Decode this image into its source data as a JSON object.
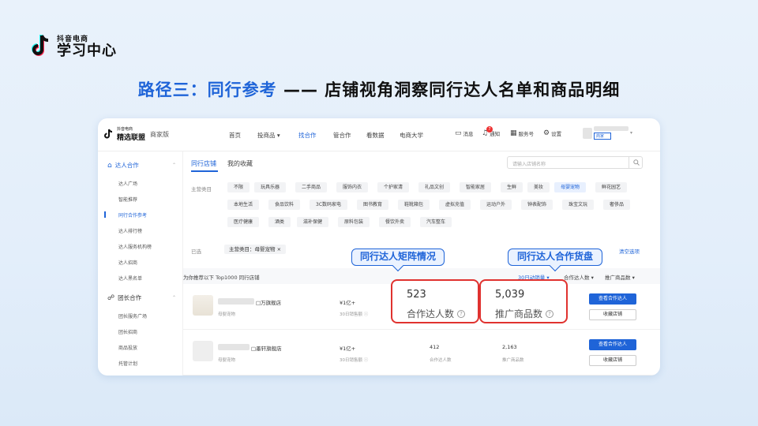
{
  "logo": {
    "top": "抖音电商",
    "main": "学习中心"
  },
  "headline": {
    "part1": "路径三：同行参考",
    "part2": " —— 店铺视角洞察同行达人名单和商品明细"
  },
  "platform": {
    "logo_small": "抖音电商",
    "logo_main": "精选联盟",
    "logo_edition": "商家版",
    "nav": [
      "首页",
      "投商品 ▾",
      "找合作",
      "管合作",
      "看数据",
      "电商大学"
    ],
    "nav_active_index": 2,
    "right": {
      "message": "消息",
      "notify": "通知",
      "notify_badge": "7",
      "service": "服务号",
      "settings": "设置",
      "user_tag": "商家"
    }
  },
  "sidebar": {
    "group1": {
      "label": "达人合作",
      "items": [
        "达人广场",
        "智能推荐",
        "同行合作参考",
        "达人排行榜",
        "达人服务机构榜",
        "达人招商",
        "达人黑名单"
      ],
      "active_index": 2
    },
    "group2": {
      "label": "团长合作",
      "items": [
        "团长服务广场",
        "团长招商",
        "商品投放",
        "托管计划"
      ]
    }
  },
  "main": {
    "tabs": [
      "同行店铺",
      "我的收藏"
    ],
    "search_placeholder": "请输入店铺名称",
    "category_label": "主营类目",
    "categories": [
      [
        "不限",
        "玩具乐器",
        "二手商品",
        "服饰内衣",
        "个护家清",
        "礼品文创",
        "智能家居",
        "生鲜",
        "美妆",
        "母婴宠物",
        "鲜花园艺"
      ],
      [
        "本地生活",
        "食品饮料",
        "3C数码家电",
        "图书教育",
        "鞋靴箱包",
        "虚拟充值",
        "运动户外",
        "钟表配饰",
        "珠宝文玩",
        "奢侈品"
      ],
      [
        "医疗健康",
        "酒类",
        "滋补保健",
        "原料包装",
        "餐饮外卖",
        "汽车整车"
      ]
    ],
    "active_category": "母婴宠物",
    "selected_label": "已选",
    "selected_chip": "主营类目：母婴宠物  ×",
    "clear_all": "清空选项",
    "list_title": "为你推荐以下 Top1000 同行店铺",
    "sort_options": [
      "30日动销量 ▾",
      "合作达人数 ▾",
      "推广商品数 ▾"
    ],
    "rows": [
      {
        "name": "□万旗舰店",
        "category": "母婴宠物",
        "sales": "¥1亿+",
        "sales_label": "30日销售额 ⓘ",
        "creators": "523",
        "creators_label": "合作达人数 ⓘ",
        "products": "5,039",
        "products_label": "推广商品数 ⓘ",
        "btn1": "查看合作达人",
        "btn2": "收藏店铺"
      },
      {
        "name": "□墨轩旗舰店",
        "category": "母婴宠物",
        "sales": "¥1亿+",
        "sales_label": "30日销售额 ⓘ",
        "creators": "412",
        "creators_label": "合作达人数",
        "products": "2,163",
        "products_label": "推广商品数",
        "btn1": "查看合作达人",
        "btn2": "收藏店铺"
      }
    ]
  },
  "callouts": {
    "left": "同行达人矩阵情况",
    "right": "同行达人合作货盘"
  },
  "highlights": {
    "left": {
      "value": "523",
      "label": "合作达人数"
    },
    "right": {
      "value": "5,039",
      "label": "推广商品数"
    }
  },
  "colors": {
    "brand_blue": "#1f64d8",
    "highlight_red": "#e0322f"
  }
}
